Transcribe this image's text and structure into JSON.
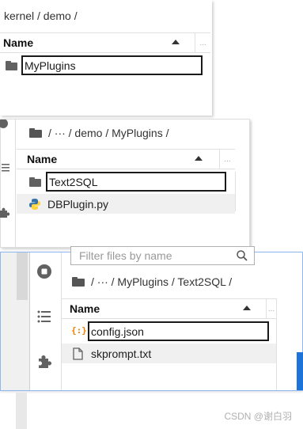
{
  "panel1": {
    "breadcrumb": "kernel / demo /",
    "header": "Name",
    "more": "...",
    "rows": [
      {
        "name": "MyPlugins",
        "type": "folder",
        "highlight": true
      }
    ]
  },
  "panel2": {
    "breadcrumb": "/  ···  / demo / MyPlugins /",
    "header": "Name",
    "more": "...",
    "rows": [
      {
        "name": "Text2SQL",
        "type": "folder",
        "highlight": true
      },
      {
        "name": "DBPlugin.py",
        "type": "python",
        "highlight": false
      }
    ]
  },
  "panel3": {
    "search_placeholder": "Filter files by name",
    "breadcrumb": "/  ···  / MyPlugins / Text2SQL /",
    "header": "Name",
    "more": "...",
    "rows": [
      {
        "name": "config.json",
        "type": "json",
        "highlight": true
      },
      {
        "name": "skprompt.txt",
        "type": "text",
        "highlight": false
      }
    ]
  },
  "watermark": "CSDN @谢白羽",
  "colors": {
    "accent_border": "#90b8f0",
    "json_icon": "#f57c00",
    "python_blue": "#3572a5",
    "python_yellow": "#ffd43b",
    "scroll_blue": "#1e73d8"
  }
}
